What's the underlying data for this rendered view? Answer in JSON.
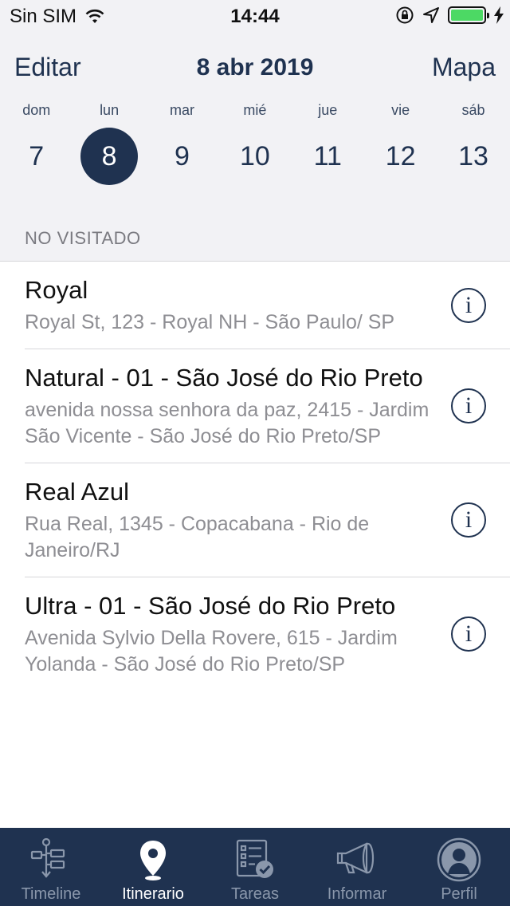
{
  "status": {
    "carrier": "Sin SIM",
    "time": "14:44",
    "battery_color": "#4cd964"
  },
  "nav": {
    "left": "Editar",
    "title": "8 abr 2019",
    "right": "Mapa"
  },
  "week": [
    {
      "dow": "dom",
      "num": "7"
    },
    {
      "dow": "lun",
      "num": "8"
    },
    {
      "dow": "mar",
      "num": "9"
    },
    {
      "dow": "mié",
      "num": "10"
    },
    {
      "dow": "jue",
      "num": "11"
    },
    {
      "dow": "vie",
      "num": "12"
    },
    {
      "dow": "sáb",
      "num": "13"
    }
  ],
  "section_header": "NO VISITADO",
  "stores": [
    {
      "name": "Royal",
      "address": "Royal St, 123 - Royal NH - São Paulo/ SP"
    },
    {
      "name": "Natural - 01 - São José do Rio Preto",
      "address": "avenida nossa senhora da paz, 2415 - Jardim São Vicente - São José do Rio Preto/SP"
    },
    {
      "name": "Real Azul",
      "address": "Rua Real, 1345 - Copacabana - Rio de Janeiro/RJ"
    },
    {
      "name": "Ultra - 01 - São José do Rio Preto",
      "address": "Avenida Sylvio Della Rovere, 615 - Jardim Yolanda - São José do Rio Preto/SP"
    }
  ],
  "tabs": [
    {
      "label": "Timeline",
      "icon": "timeline-icon"
    },
    {
      "label": "Itinerario",
      "icon": "location-pin-icon"
    },
    {
      "label": "Tareas",
      "icon": "task-checklist-icon"
    },
    {
      "label": "Informar",
      "icon": "megaphone-icon"
    },
    {
      "label": "Perfil",
      "icon": "profile-icon"
    }
  ],
  "colors": {
    "brand_navy": "#1f3250",
    "tab_inactive": "#8a97ab"
  }
}
